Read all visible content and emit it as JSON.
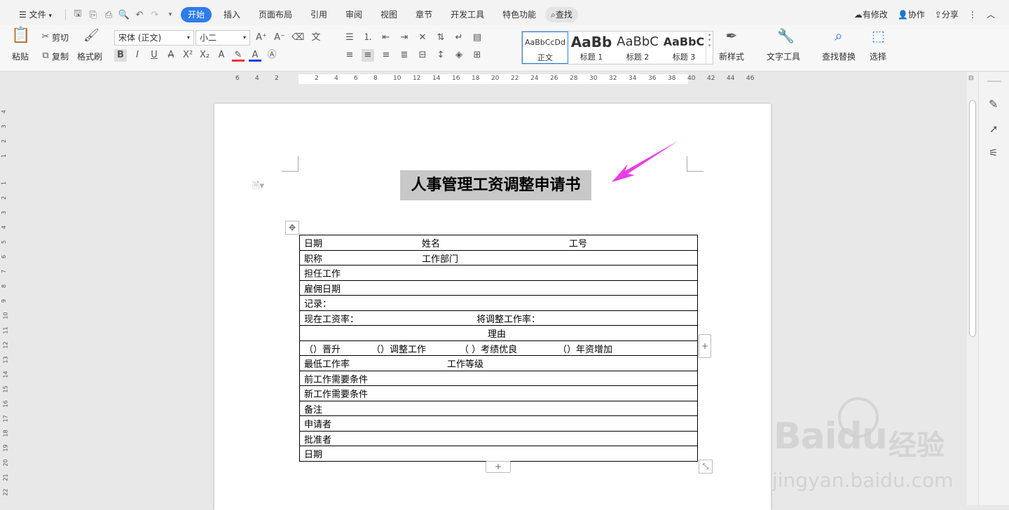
{
  "menu": {
    "file": "文件",
    "tabs": [
      "开始",
      "插入",
      "页面布局",
      "引用",
      "审阅",
      "视图",
      "章节",
      "开发工具",
      "特色功能"
    ],
    "search": "查找",
    "right": [
      "有修改",
      "协作",
      "分享"
    ]
  },
  "ribbon": {
    "paste": "粘贴",
    "cut": "剪切",
    "copy": "复制",
    "format_painter": "格式刷",
    "font_name": "宋体 (正文)",
    "font_size": "小二",
    "new_style": "新样式",
    "text_tools": "文字工具",
    "find_replace": "查找替换",
    "select": "选择",
    "styles": [
      {
        "preview": "AaBbCcDd",
        "label": "正文"
      },
      {
        "preview": "AaBb",
        "label": "标题 1"
      },
      {
        "preview": "AaBbC",
        "label": "标题 2"
      },
      {
        "preview": "AaBbC",
        "label": "标题 3"
      }
    ]
  },
  "ruler": {
    "h": [
      "6",
      "4",
      "2",
      "2",
      "4",
      "6",
      "8",
      "10",
      "12",
      "14",
      "16",
      "18",
      "20",
      "22",
      "24",
      "26",
      "28",
      "30",
      "32",
      "34",
      "36",
      "38",
      "40",
      "42",
      "44",
      "46"
    ],
    "v": [
      "4",
      "3",
      "2",
      "1",
      "1",
      "2",
      "3",
      "4",
      "5",
      "6",
      "7",
      "8",
      "9",
      "10",
      "11",
      "12",
      "13",
      "14",
      "15",
      "16",
      "17",
      "18",
      "19",
      "20",
      "21",
      "22"
    ]
  },
  "document": {
    "title": "人事管理工资调整申请书",
    "rows": [
      [
        "日期",
        "姓名",
        "工号"
      ],
      [
        "职称",
        "工作部门"
      ],
      [
        "担任工作"
      ],
      [
        "雇佣日期"
      ],
      [
        "记录："
      ],
      [
        "现在工资率：",
        "将调整工作率："
      ],
      [
        "理由"
      ],
      [
        "（）晋升",
        "（）调整工作",
        "（ ）考绩优良",
        "（）年资增加"
      ],
      [
        "最低工作率",
        "工作等级"
      ],
      [
        "前工作需要条件"
      ],
      [
        "新工作需要条件"
      ],
      [
        "备注"
      ],
      [
        "申请者"
      ],
      [
        "批准者"
      ],
      [
        "日期"
      ]
    ]
  },
  "watermark": {
    "brand": "Baidu",
    "cn": "经验",
    "url": "jingyan.baidu.com"
  },
  "colors": {
    "accent": "#2e7de9",
    "arrow": "#e83ee8"
  }
}
